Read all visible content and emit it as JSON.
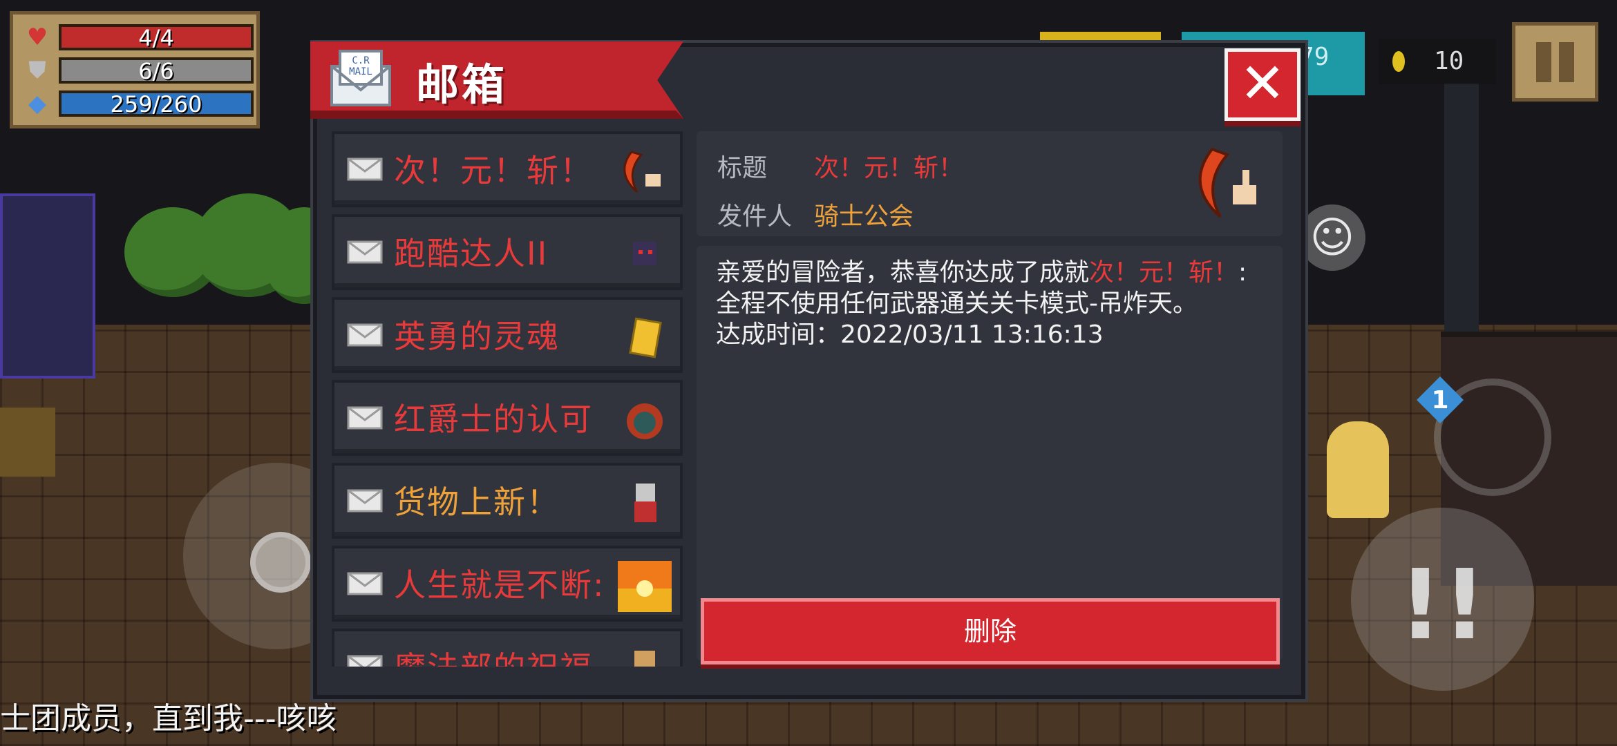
{
  "hud": {
    "hp": "4/4",
    "armor": "6/6",
    "energy": "259/260",
    "coins": "10",
    "gems_partial": "79"
  },
  "mailbox": {
    "title": "邮箱",
    "close_label": "✕",
    "mails": [
      {
        "label": "次！元！斩！",
        "color": "#e83a3a",
        "thumb_icon": "crescent-blade-icon"
      },
      {
        "label": "跑酷达人II",
        "color": "#e83a3a",
        "thumb_icon": "ninja-icon"
      },
      {
        "label": "英勇的灵魂",
        "color": "#e83a3a",
        "thumb_icon": "scroll-icon"
      },
      {
        "label": "红爵士的认可",
        "color": "#e83a3a",
        "thumb_icon": "demon-helmet-icon"
      },
      {
        "label": "货物上新！",
        "color": "#f0a23a",
        "thumb_icon": "merchant-icon"
      },
      {
        "label": "人生就是不断:",
        "color": "#e83a3a",
        "thumb_icon": "sunset-icon"
      },
      {
        "label": "魔法部的祝福",
        "color": "#e83a3a",
        "thumb_icon": "book-icon"
      }
    ],
    "detail": {
      "title_label": "标题",
      "title_value": "次！元！斩！",
      "sender_label": "发件人",
      "sender_value": "骑士公会",
      "body_prefix": "亲爱的冒险者，恭喜你达成了成就",
      "body_highlight": "次！元！斩！",
      "body_suffix": ":全程不使用任何武器通关关卡模式-吊炸天。",
      "body_time": "达成时间：2022/03/11 13:16:13",
      "delete_label": "删除"
    }
  },
  "controls": {
    "swap_count": "1",
    "skill_label": "!!"
  },
  "ticker": "士团成员，直到我---咳咳",
  "colors": {
    "accent_red": "#d3262e",
    "mail_red": "#e83a3a",
    "mail_orange": "#f0a23a",
    "panel": "#2a2d35"
  }
}
